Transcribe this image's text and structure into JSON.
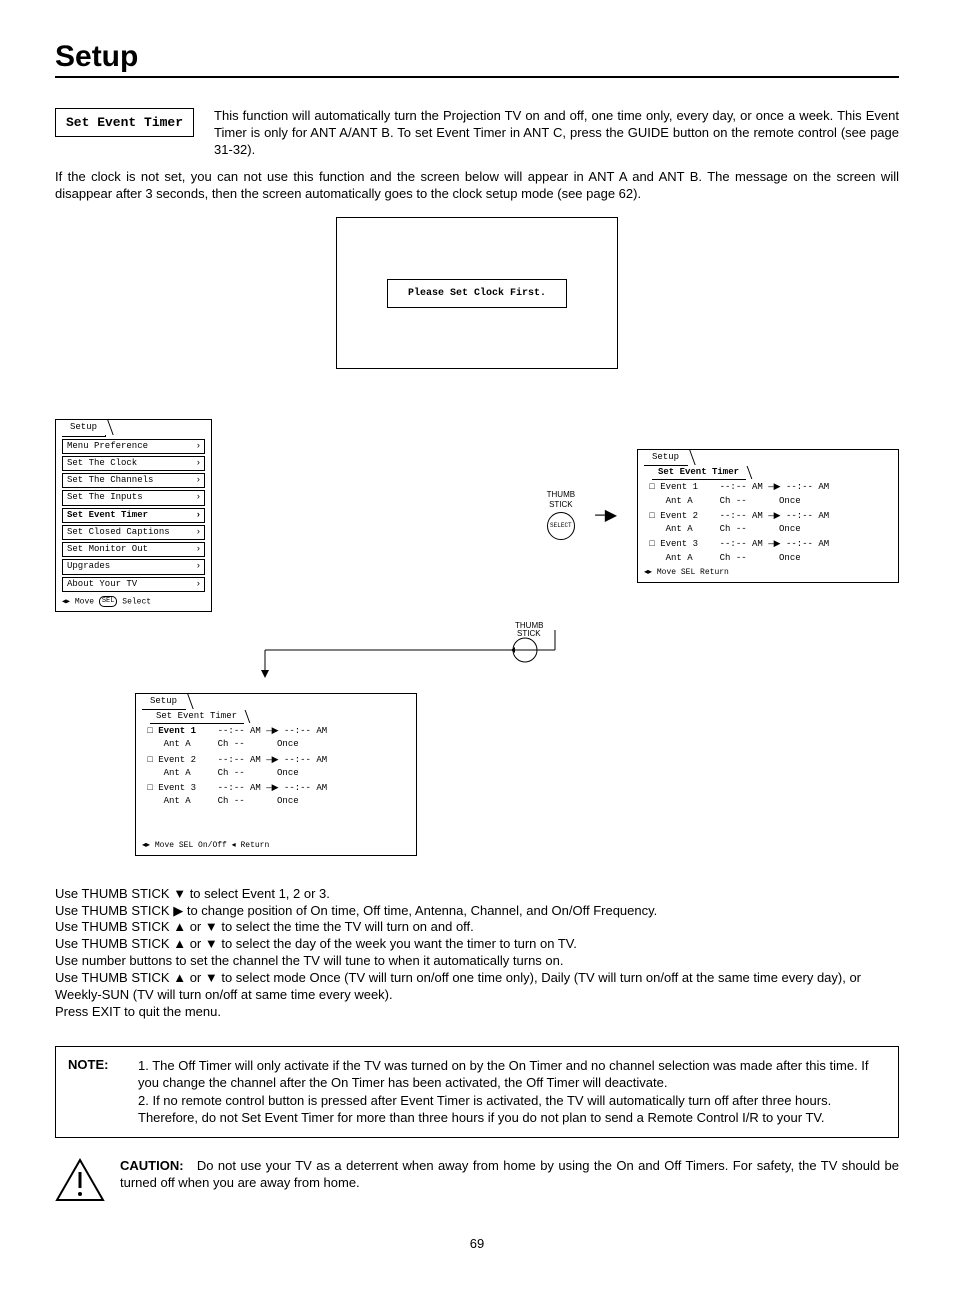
{
  "title": "Setup",
  "section_label": "Set Event Timer",
  "intro": "This function will automatically turn the Projection TV on and off, one time only, every day, or once a week.  This Event Timer is only for ANT A/ANT B.  To set Event Timer in ANT C, press the GUIDE button on the remote control (see page 31-32).",
  "clock_warning_para": "If the clock is not set, you can not use this function and the screen below will appear in ANT A and ANT B.  The message on the screen will disappear after 3 seconds, then the screen automatically goes to the clock setup mode (see page 62).",
  "clock_msg": "Please Set Clock First.",
  "menu_a": {
    "title": "Setup",
    "items": [
      "Menu Preference",
      "Set The Clock",
      "Set The Channels",
      "Set The Inputs",
      "Set Event Timer",
      "Set Closed Captions",
      "Set Monitor Out",
      "Upgrades",
      "About Your TV"
    ],
    "selected_index": 4,
    "footer_move": "Move",
    "footer_sel": "SEL",
    "footer_select": "Select"
  },
  "thumb_label": "THUMB\nSTICK",
  "thumb_select": "SELECT",
  "menu_b": {
    "title": "Setup",
    "subtitle": "Set Event Timer",
    "events": [
      {
        "label": "Event 1",
        "time": "--:-- AM —▶ --:-- AM",
        "sub": "Ant A     Ch --      Once"
      },
      {
        "label": "Event 2",
        "time": "--:-- AM —▶ --:-- AM",
        "sub": "Ant A     Ch --      Once"
      },
      {
        "label": "Event 3",
        "time": "--:-- AM —▶ --:-- AM",
        "sub": "Ant A     Ch --      Once"
      }
    ],
    "footer": "Move  SEL  Return"
  },
  "menu_c": {
    "title": "Setup",
    "subtitle": "Set Event Timer",
    "events": [
      {
        "label": "Event 1",
        "sel": true,
        "time": "--:-- AM —▶ --:-- AM",
        "sub": "Ant A     Ch --      Once"
      },
      {
        "label": "Event 2",
        "sel": false,
        "time": "--:-- AM —▶ --:-- AM",
        "sub": "Ant A     Ch --      Once"
      },
      {
        "label": "Event 3",
        "sel": false,
        "time": "--:-- AM —▶ --:-- AM",
        "sub": "Ant A     Ch --      Once"
      }
    ],
    "footer": "Move  SEL  On/Off  ◂  Return"
  },
  "instructions": [
    "Use THUMB STICK ▼ to select Event 1, 2 or 3.",
    "Use THUMB STICK ▶ to change position of On time, Off time, Antenna, Channel, and On/Off Frequency.",
    "Use THUMB STICK ▲ or ▼ to select the time the TV will turn on and off.",
    "Use THUMB STICK ▲ or ▼ to select the day of the week you want the timer to turn on TV.",
    "Use number buttons to set the channel the TV will tune to when it automatically turns on.",
    "Use THUMB STICK ▲ or ▼ to select mode Once (TV will turn on/off one time only), Daily (TV will turn on/off at the same time every day), or Weekly-SUN (TV will turn on/off at same time every week).",
    "Press EXIT to quit the menu."
  ],
  "note_label": "NOTE:",
  "note_item1": "1. The Off Timer will only activate if the TV was turned on by the On Timer and no channel selection was made after this time.  If you change the channel after the On Timer has been activated, the Off Timer will deactivate.",
  "note_item2": "2. If no remote control button is pressed after Event Timer is activated, the TV will automatically turn off after three hours.  Therefore, do not Set Event Timer for more than three hours if you do not plan to send a Remote Control I/R to your TV.",
  "caution_label": "CAUTION:",
  "caution_text": "Do not use your TV as a deterrent when away from home by using the On and Off Timers.  For safety, the TV should be turned off when you are away from home.",
  "page_number": "69"
}
